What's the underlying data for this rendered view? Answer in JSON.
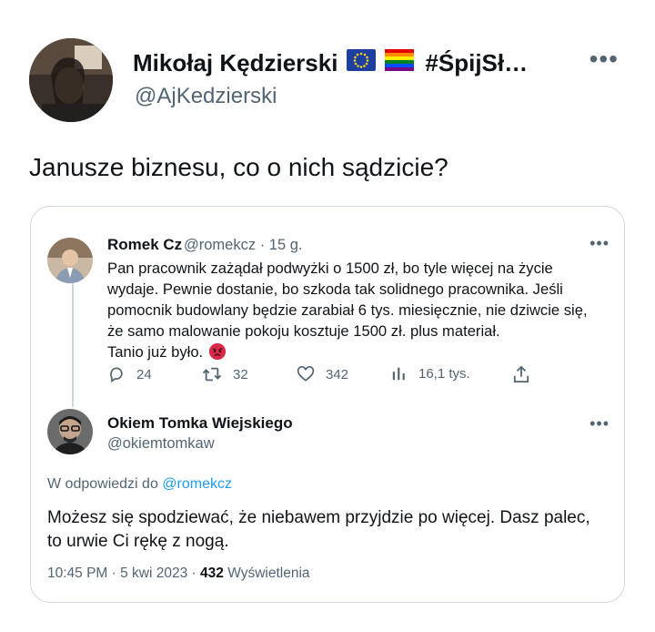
{
  "author": {
    "name": "Mikołaj Kędzierski",
    "name_suffix": "#ŚpijSł…",
    "handle": "@AjKedzierski"
  },
  "tweet": {
    "text": "Janusze biznesu, co o nich sądzicie?"
  },
  "quoted_tweet": {
    "author_name": "Romek Cz",
    "author_handle": "@romekcz",
    "separator": "·",
    "time_ago": "15 g.",
    "body_lines": [
      "Pan pracownik zażądał podwyżki o 1500 zł, bo tyle więcej na życie",
      "wydaje. Pewnie dostanie, bo szkoda tak solidnego pracownika. Jeśli",
      "pomocnik budowlany będzie zarabiał 6 tys. miesięcznie, nie dziwcie się,",
      "że samo malowanie pokoju kosztuje 1500 zł. plus materiał.",
      "Tanio już było."
    ],
    "emoji_icon": "angry-face-icon",
    "stats": {
      "replies": "24",
      "retweets": "32",
      "likes": "342",
      "views": "16,1 tys."
    }
  },
  "reply": {
    "author_name": "Okiem Tomka Wiejskiego",
    "author_handle": "@okiemtomkaw",
    "reply_to_prefix": "W odpowiedzi do",
    "reply_to_handle": "@romekcz",
    "body_lines": [
      "Możesz się spodziewać, że niebawem przyjdzie po więcej. Dasz palec,",
      "to urwie Ci rękę z nogą."
    ],
    "timestamp": "10:45 PM · 5 kwi 2023",
    "dot": "·",
    "views_count": "432",
    "views_label": "Wyświetlenia"
  },
  "colors": {
    "text_primary": "#0f1419",
    "text_secondary": "#536471",
    "link": "#1d9bf0",
    "border": "#cfd9de"
  }
}
